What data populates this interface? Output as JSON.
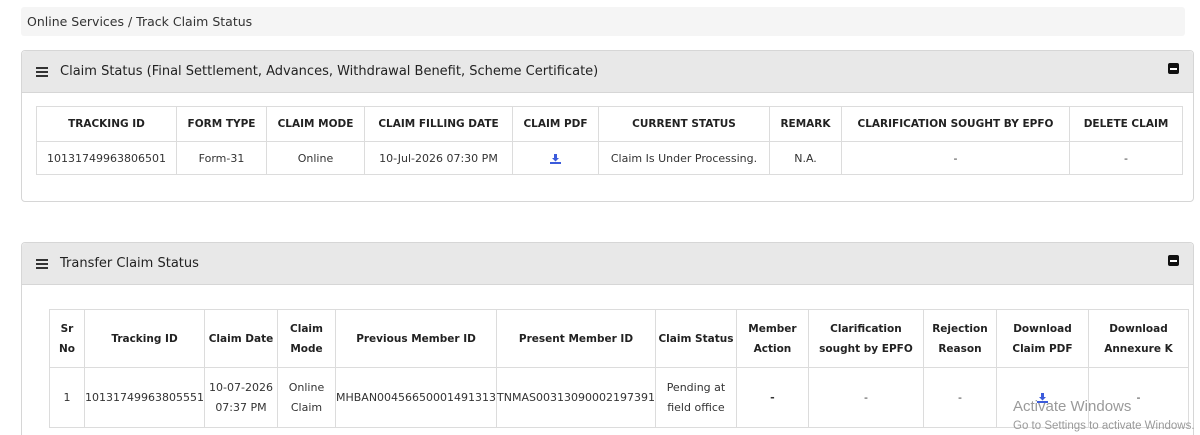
{
  "breadcrumb": {
    "text": "Online Services / Track Claim Status"
  },
  "claim_panel": {
    "title": "Claim Status (Final Settlement, Advances, Withdrawal Benefit, Scheme Certificate)",
    "headers": [
      "TRACKING ID",
      "FORM TYPE",
      "CLAIM MODE",
      "CLAIM FILLING DATE",
      "CLAIM PDF",
      "CURRENT STATUS",
      "REMARK",
      "CLARIFICATION SOUGHT BY EPFO",
      "DELETE CLAIM"
    ],
    "row": {
      "tracking_id": "10131749963806501",
      "form_type": "Form-31",
      "claim_mode": "Online",
      "filing_date": "10-Jul-2026 07:30 PM",
      "claim_pdf_icon": "download-icon",
      "current_status": "Claim Is Under Processing.",
      "remark": "N.A.",
      "clarification": "-",
      "delete": "-"
    }
  },
  "transfer_panel": {
    "title": "Transfer Claim Status",
    "headers": {
      "sr_no_1": "Sr",
      "sr_no_2": "No",
      "tracking_id": "Tracking ID",
      "claim_date": "Claim Date",
      "claim_mode_1": "Claim",
      "claim_mode_2": "Mode",
      "prev_member": "Previous Member ID",
      "present_member": "Present Member ID",
      "claim_status": "Claim Status",
      "member_action_1": "Member",
      "member_action_2": "Action",
      "clarification_1": "Clarification",
      "clarification_2": "sought by EPFO",
      "rejection_1": "Rejection",
      "rejection_2": "Reason",
      "download_pdf_1": "Download",
      "download_pdf_2": "Claim PDF",
      "download_annex_1": "Download",
      "download_annex_2": "Annexure K"
    },
    "row": {
      "sr_no": "1",
      "tracking_id": "10131749963805551",
      "claim_date_1": "10-07-2026",
      "claim_date_2": "07:37 PM",
      "claim_mode_1": "Online",
      "claim_mode_2": "Claim",
      "prev_member": "MHBAN00456650001491313",
      "present_member": "TNMAS00313090002197391",
      "claim_status_1": "Pending at",
      "claim_status_2": "field office",
      "member_action": "-",
      "clarification": "-",
      "rejection": "-",
      "download_pdf_icon": "download-icon",
      "annexure": "-"
    }
  },
  "watermark": {
    "line1": "Activate Windows",
    "line2": "Go to Settings to activate Windows."
  },
  "colors": {
    "accent": "#3b5bdb",
    "header_bg": "#e8e8e8"
  }
}
